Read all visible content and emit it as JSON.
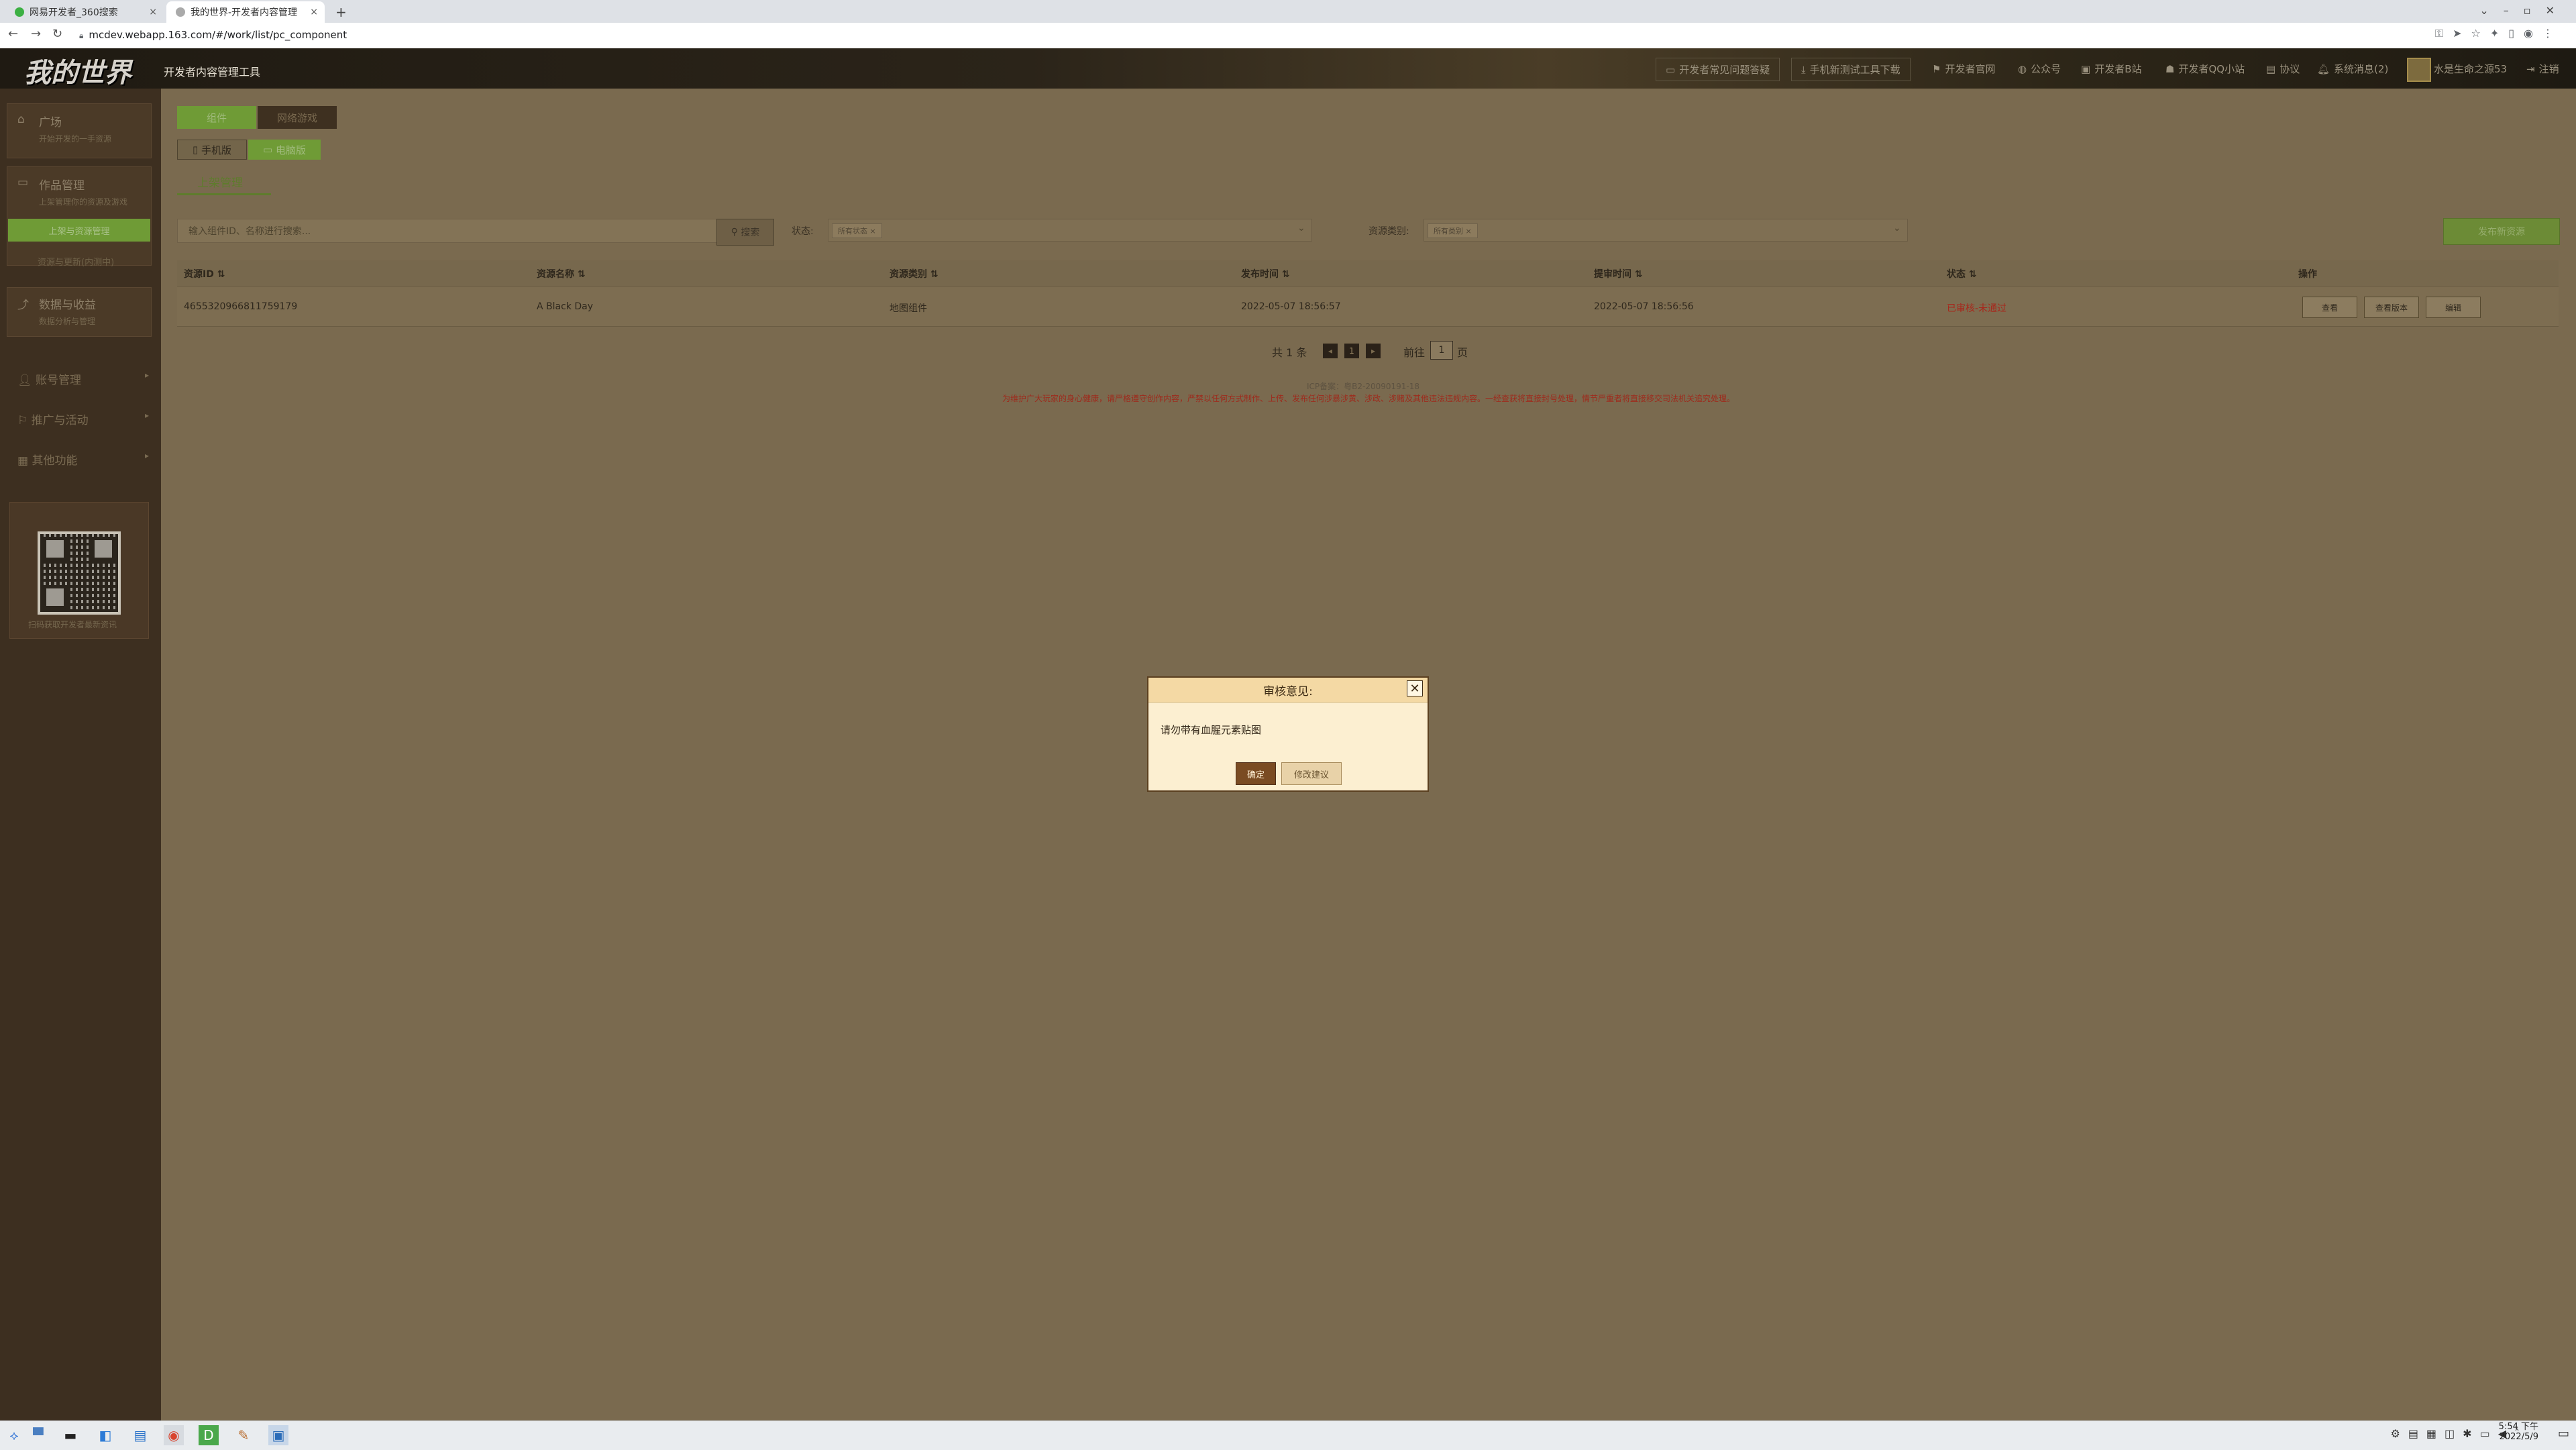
{
  "browser": {
    "tabs": [
      {
        "title": "网易开发者_360搜索"
      },
      {
        "title": "我的世界-开发者内容管理"
      }
    ],
    "url": "mcdev.webapp.163.com/#/work/list/pc_component",
    "new_tab_label": "+"
  },
  "header": {
    "logo": "我的世界",
    "tool_name": "开发者内容管理工具",
    "nav": [
      {
        "icon": "chat-icon",
        "label": "开发者常见问题答疑"
      },
      {
        "icon": "download-icon",
        "label": "手机新测试工具下载"
      },
      {
        "icon": "flag-icon",
        "label": "开发者官网"
      },
      {
        "icon": "wechat-icon",
        "label": "公众号"
      },
      {
        "icon": "tv-icon",
        "label": "开发者B站"
      },
      {
        "icon": "qq-icon",
        "label": "开发者QQ小站"
      },
      {
        "icon": "doc-icon",
        "label": "协议"
      },
      {
        "icon": "bell-icon",
        "label": "系统消息(2)"
      }
    ],
    "user_name": "水是生命之源53",
    "logout_label": "注销"
  },
  "sidebar": {
    "plaza": {
      "title": "广场",
      "subtitle": "开始开发的一手资源"
    },
    "works": {
      "title": "作品管理",
      "subtitle": "上架管理你的资源及游戏"
    },
    "active_item": "上架与资源管理",
    "sub_link": "资源与更新(内测中)",
    "data": {
      "title": "数据与收益",
      "subtitle": "数据分析与管理"
    },
    "menus": [
      {
        "icon": "user-icon",
        "label": "账号管理"
      },
      {
        "icon": "megaphone-icon",
        "label": "推广与活动"
      },
      {
        "icon": "grid-icon",
        "label": "其他功能"
      }
    ],
    "qr_caption": "扫码获取开发者最新资讯"
  },
  "main": {
    "top_tabs": [
      "组件",
      "网络游戏"
    ],
    "platform_tabs": [
      "手机版",
      "电脑版"
    ],
    "section_tab": "上架管理",
    "search": {
      "placeholder": "输入组件ID、名称进行搜索...",
      "button": "搜索"
    },
    "status_filter": {
      "label": "状态:",
      "chip": "所有状态"
    },
    "type_filter": {
      "label": "资源类别:",
      "chip": "所有类别"
    },
    "publish_button": "发布新资源",
    "table": {
      "columns": [
        "资源ID",
        "资源名称",
        "资源类别",
        "发布时间",
        "提审时间",
        "状态",
        "操作"
      ],
      "rows": [
        {
          "id": "4655320966811759179",
          "name": "A Black Day",
          "type": "地图组件",
          "publish_time": "2022-05-07 18:56:57",
          "review_time": "2022-05-07 18:56:56",
          "status": "已审核-未通过",
          "actions": [
            "查看",
            "查看版本",
            "编辑"
          ]
        }
      ]
    },
    "pagination": {
      "total": "共 1 条",
      "current": "1",
      "goto_label": "前往",
      "goto_value": "1",
      "page_unit": "页"
    },
    "icp": "ICP备案：粤B2-20090191-18",
    "notice": "为维护广大玩家的身心健康，请严格遵守创作内容，严禁以任何方式制作、上传、发布任何涉暴涉黄、涉政、涉赌及其他违法违规内容。一经查获将直接封号处理，情节严重者将直接移交司法机关追究处理。"
  },
  "dialog": {
    "title": "审核意见:",
    "message": "请勿带有血腥元素贴图",
    "ok": "确定",
    "suggest": "修改建议"
  },
  "taskbar": {
    "time": "5:54 下午",
    "date": "2022/5/9"
  },
  "colors": {
    "accent_green": "#6f9b36",
    "dialog_bg": "#fcefd1",
    "error_red": "#c8261a",
    "overlay_main": "#7a6a4f"
  }
}
